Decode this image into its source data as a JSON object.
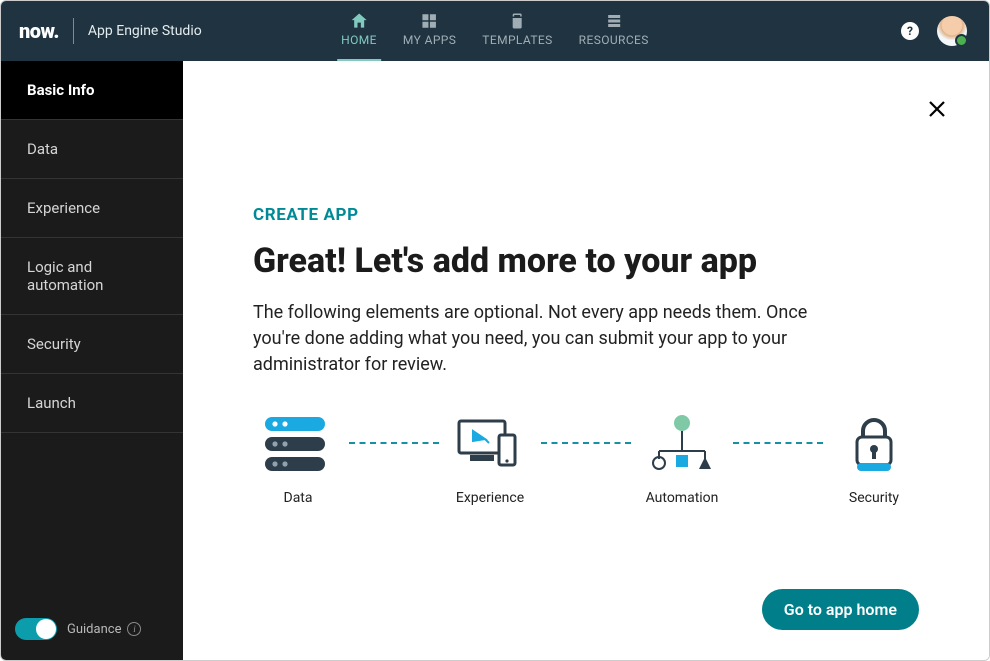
{
  "brand": {
    "logo": "now.",
    "subtitle": "App Engine Studio"
  },
  "topnav": {
    "items": [
      {
        "label": "HOME",
        "icon": "home-icon",
        "active": true
      },
      {
        "label": "MY APPS",
        "icon": "apps-icon",
        "active": false
      },
      {
        "label": "TEMPLATES",
        "icon": "templates-icon",
        "active": false
      },
      {
        "label": "RESOURCES",
        "icon": "resources-icon",
        "active": false
      }
    ],
    "help": "?",
    "avatar_status": "online"
  },
  "sidebar": {
    "items": [
      {
        "label": "Basic Info",
        "active": true
      },
      {
        "label": "Data",
        "active": false
      },
      {
        "label": "Experience",
        "active": false
      },
      {
        "label": "Logic and automation",
        "active": false
      },
      {
        "label": "Security",
        "active": false
      },
      {
        "label": "Launch",
        "active": false
      }
    ],
    "guidance_label": "Guidance",
    "guidance_on": true
  },
  "main": {
    "eyebrow": "CREATE APP",
    "headline": "Great! Let's add more to your app",
    "description": "The following elements are optional. Not every app needs them. Once you're done adding what you need, you can submit your app to your administrator for review.",
    "steps": [
      {
        "label": "Data"
      },
      {
        "label": "Experience"
      },
      {
        "label": "Automation"
      },
      {
        "label": "Security"
      }
    ],
    "cta": "Go to app home"
  }
}
